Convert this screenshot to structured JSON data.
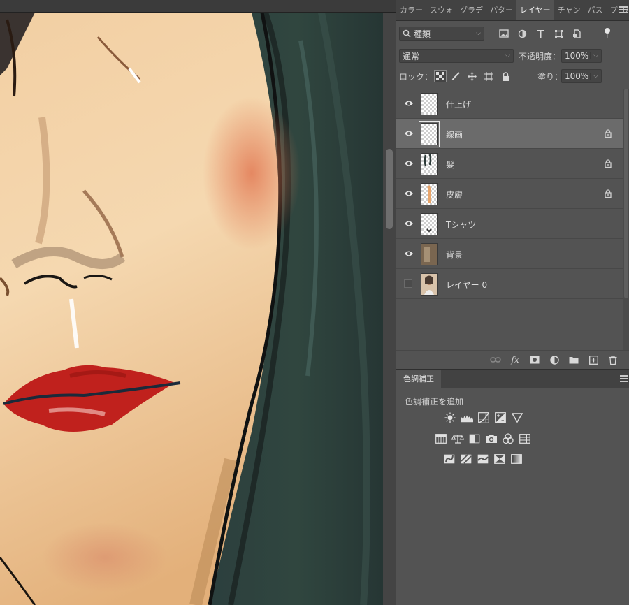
{
  "panel_tabs": [
    {
      "label": "カラー",
      "active": false
    },
    {
      "label": "スウォ",
      "active": false
    },
    {
      "label": "グラデ",
      "active": false
    },
    {
      "label": "パター",
      "active": false
    },
    {
      "label": "レイヤー",
      "active": true
    },
    {
      "label": "チャン",
      "active": false
    },
    {
      "label": "パス",
      "active": false
    },
    {
      "label": "プロパ",
      "active": false
    }
  ],
  "filter": {
    "kind_value": "種類"
  },
  "blend": {
    "mode_value": "通常",
    "opacity_label": "不透明度：",
    "opacity_value": "100%"
  },
  "lock": {
    "label": "ロック：",
    "fill_label": "塗り：",
    "fill_value": "100%"
  },
  "layers": [
    {
      "name": "仕上げ",
      "visible": true,
      "locked": false,
      "selected": false
    },
    {
      "name": "線画",
      "visible": true,
      "locked": true,
      "selected": true
    },
    {
      "name": "髪",
      "visible": true,
      "locked": true,
      "selected": false
    },
    {
      "name": "皮膚",
      "visible": true,
      "locked": true,
      "selected": false
    },
    {
      "name": "Tシャツ",
      "visible": true,
      "locked": false,
      "selected": false
    },
    {
      "name": "背景",
      "visible": true,
      "locked": false,
      "selected": false
    },
    {
      "name": "レイヤー 0",
      "visible": false,
      "locked": false,
      "selected": false
    }
  ],
  "layer_tools": {
    "fx_label": "fx"
  },
  "adjustments": {
    "tab_label": "色調補正",
    "title": "色調補正を追加"
  },
  "colors": {
    "panel_bg": "#535353",
    "tabbar_bg": "#424242",
    "selected_row": "#6b6b6b",
    "canvas_skin": "#e9c9a0",
    "lip_red": "#c0211d",
    "hair_teal": "#2e4240"
  }
}
